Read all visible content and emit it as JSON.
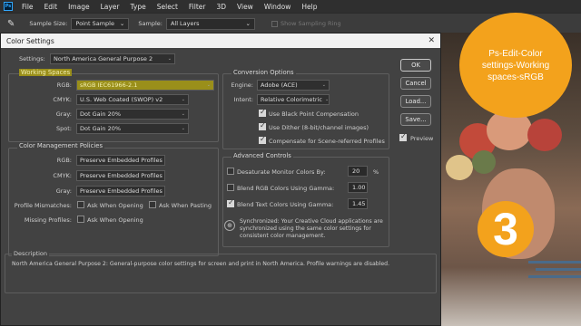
{
  "app": {
    "menu": [
      "File",
      "Edit",
      "Image",
      "Layer",
      "Type",
      "Select",
      "Filter",
      "3D",
      "View",
      "Window",
      "Help"
    ],
    "options_bar": {
      "sample_size_label": "Sample Size:",
      "sample_size_value": "Point Sample",
      "sample_label": "Sample:",
      "sample_value": "All Layers",
      "show_ring_label": "Show Sampling Ring"
    }
  },
  "dialog": {
    "title": "Color Settings",
    "settings_label": "Settings:",
    "settings_value": "North America General Purpose 2",
    "working_spaces": {
      "title": "Working Spaces",
      "rgb_label": "RGB:",
      "rgb_value": "sRGB IEC61966-2.1",
      "cmyk_label": "CMYK:",
      "cmyk_value": "U.S. Web Coated (SWOP) v2",
      "gray_label": "Gray:",
      "gray_value": "Dot Gain 20%",
      "spot_label": "Spot:",
      "spot_value": "Dot Gain 20%"
    },
    "policies": {
      "title": "Color Management Policies",
      "rgb_label": "RGB:",
      "rgb_value": "Preserve Embedded Profiles",
      "cmyk_label": "CMYK:",
      "cmyk_value": "Preserve Embedded Profiles",
      "gray_label": "Gray:",
      "gray_value": "Preserve Embedded Profiles",
      "mismatches_label": "Profile Mismatches:",
      "ask_opening": "Ask When Opening",
      "ask_pasting": "Ask When Pasting",
      "missing_label": "Missing Profiles:",
      "missing_ask_opening": "Ask When Opening"
    },
    "conversion": {
      "title": "Conversion Options",
      "engine_label": "Engine:",
      "engine_value": "Adobe (ACE)",
      "intent_label": "Intent:",
      "intent_value": "Relative Colorimetric",
      "black_point": "Use Black Point Compensation",
      "dither": "Use Dither (8-bit/channel images)",
      "compensate": "Compensate for Scene-referred Profiles"
    },
    "advanced": {
      "title": "Advanced Controls",
      "desaturate_label": "Desaturate Monitor Colors By:",
      "desaturate_value": "20",
      "desaturate_unit": "%",
      "blend_rgb_label": "Blend RGB Colors Using Gamma:",
      "blend_rgb_value": "1.00",
      "blend_text_label": "Blend Text Colors Using Gamma:",
      "blend_text_value": "1.45"
    },
    "sync_text": "Synchronized: Your Creative Cloud applications are synchronized using the same color settings for consistent color management.",
    "description": {
      "title": "Description",
      "text": "North America General Purpose 2:  General-purpose color settings for screen and print in North America. Profile warnings are disabled."
    },
    "buttons": {
      "ok": "OK",
      "cancel": "Cancel",
      "load": "Load...",
      "save": "Save...",
      "preview": "Preview"
    }
  },
  "overlay": {
    "bubble_text": "Ps-Edit-Color settings-Working spaces-sRGB",
    "step_number": "3"
  },
  "colors": {
    "accent_bubble": "#f3a21c",
    "highlight": "#9a8f1a"
  }
}
